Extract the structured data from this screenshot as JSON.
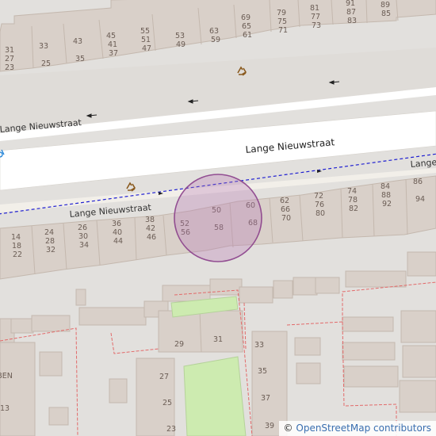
{
  "map": {
    "streets": {
      "main_label": "Lange Nieuwstraat",
      "lower_label": "Lange Nieuwstraat",
      "upper_label": "Lange Nieuwstraat",
      "right_label": "Lange"
    },
    "house_numbers": {
      "top_row": [
        "31",
        "27",
        "23",
        "33",
        "25",
        "43",
        "35",
        "45",
        "41",
        "37",
        "55",
        "51",
        "47",
        "53",
        "49",
        "63",
        "59",
        "69",
        "65",
        "61",
        "79",
        "75",
        "71",
        "81",
        "77",
        "73",
        "91",
        "87",
        "83",
        "89",
        "85"
      ],
      "bottom_row": [
        "14",
        "18",
        "22",
        "24",
        "28",
        "32",
        "26",
        "30",
        "34",
        "36",
        "40",
        "44",
        "38",
        "42",
        "46",
        "52",
        "56",
        "50",
        "58",
        "60",
        "68",
        "62",
        "66",
        "70",
        "72",
        "76",
        "80",
        "74",
        "78",
        "82",
        "84",
        "88",
        "92",
        "86",
        "94"
      ],
      "rear": [
        "29",
        "31",
        "33",
        "35",
        "37",
        "39",
        "27",
        "25",
        "23",
        "13"
      ],
      "partial_label": "BEN"
    },
    "icons": [
      "recycling-icon",
      "recycling-icon",
      "oneway-arrow-icon",
      "bicycle-icon"
    ],
    "marker": {
      "fill": "#b678b4",
      "stroke": "#8a3f8a"
    }
  },
  "attribution": {
    "copyright_symbol": "©",
    "text": "OpenStreetMap contributors"
  }
}
